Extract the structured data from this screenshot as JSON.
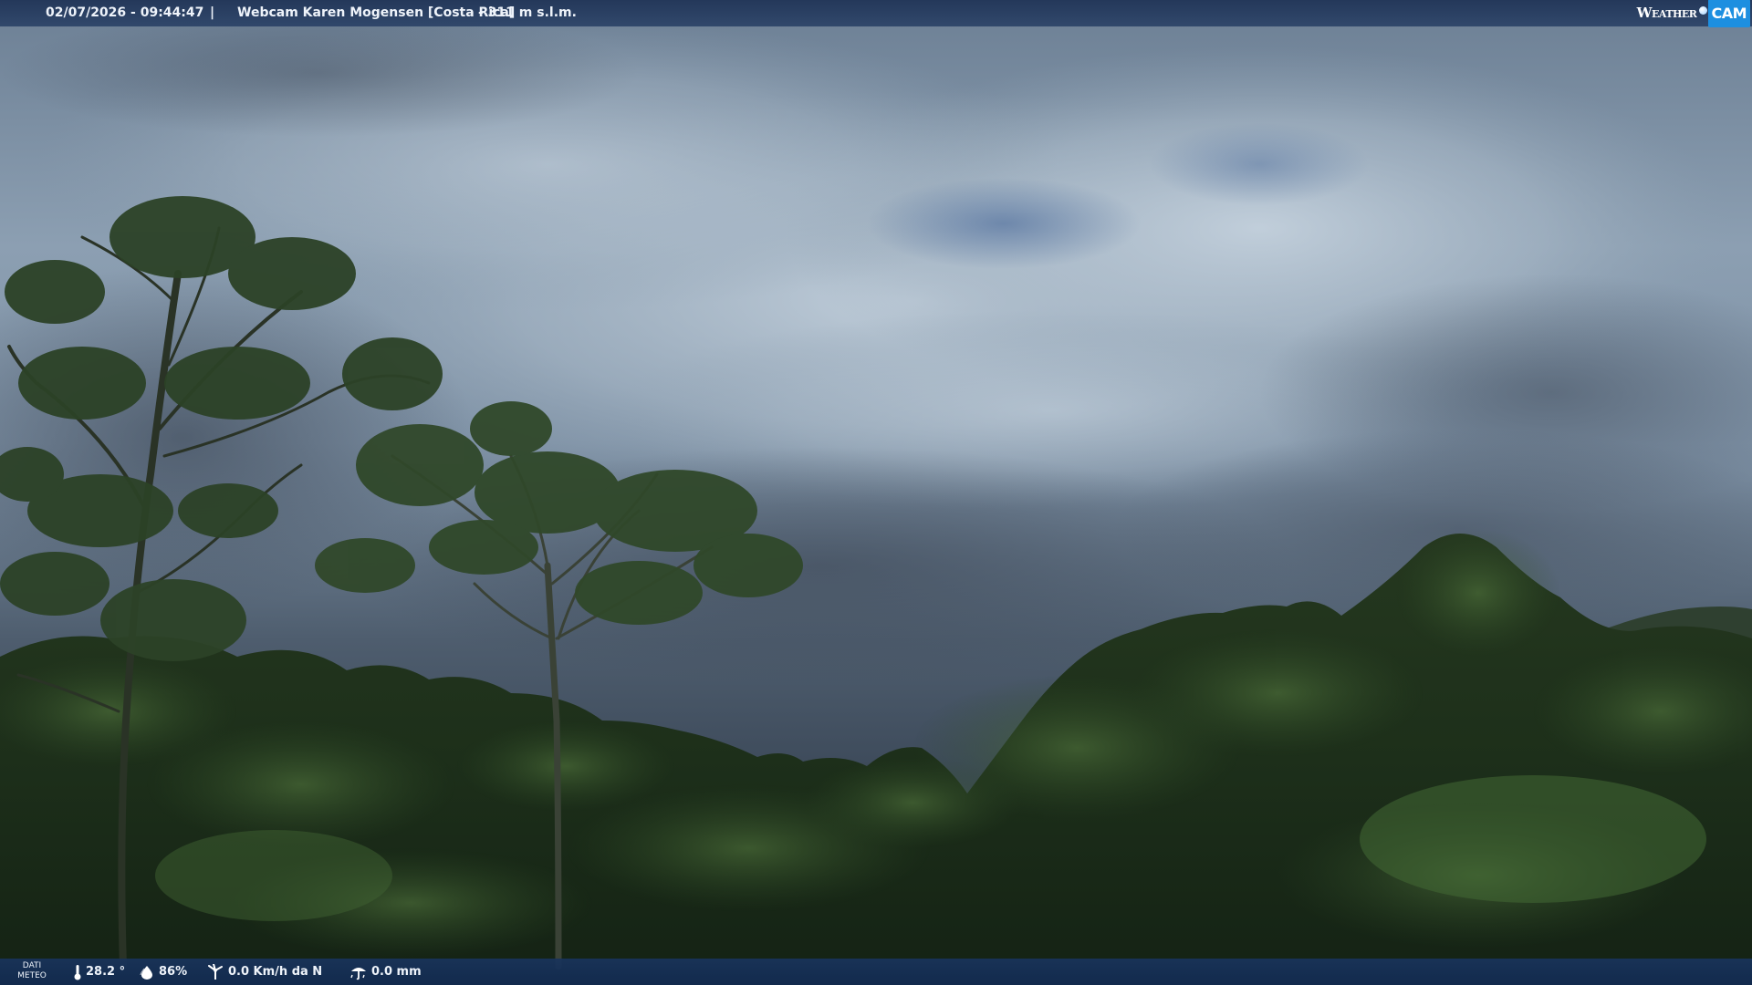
{
  "overlay_top": {
    "timestamp": "02/07/2026 - 09:44:47",
    "separator": "|",
    "title": "Webcam Karen Mogensen [Costa Rica]",
    "elevation": "- 311 m s.l.m.",
    "logo_weather": "Weather",
    "logo_cam": "CAM"
  },
  "overlay_bottom": {
    "label_line1": "DATI",
    "label_line2": "METEO",
    "temperature": "28.2 °",
    "humidity": "86%",
    "wind": "0.0 Km/h da N",
    "rain": "0.0 mm",
    "icons": [
      "thermometer-icon",
      "humidity-drop-icon",
      "wind-icon",
      "rain-icon"
    ]
  },
  "colors": {
    "bar_background": "#1e3a66",
    "logo_accent": "#1d8fe0",
    "sky": "#7f93a6",
    "foliage": "#1f3320"
  }
}
